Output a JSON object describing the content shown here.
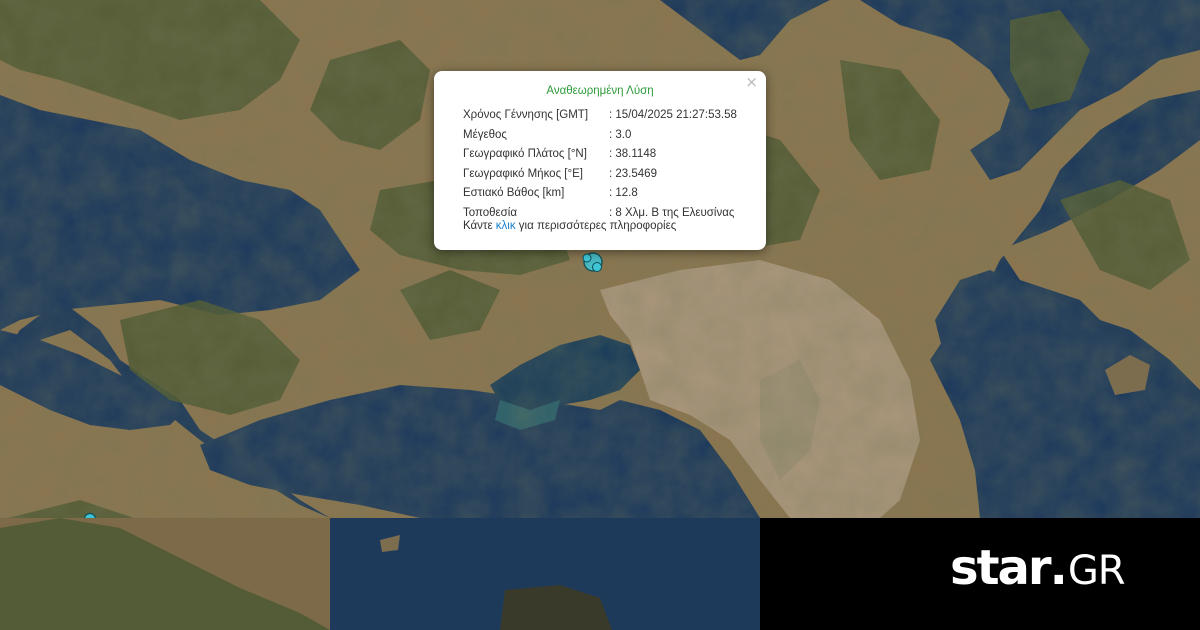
{
  "popup": {
    "title": "Αναθεωρημένη Λύση",
    "close": "×",
    "rows": [
      {
        "label": "Χρόνος Γέννησης [GMT]",
        "value": ": 15/04/2025 21:27:53.58"
      },
      {
        "label": "Μέγεθος",
        "value": ": 3.0"
      },
      {
        "label": "Γεωγραφικό Πλάτος [°N]",
        "value": ": 38.1148"
      },
      {
        "label": "Γεωγραφικό Μήκος [°E]",
        "value": ": 23.5469"
      },
      {
        "label": "Εστιακό Βάθος [km]",
        "value": ": 12.8"
      },
      {
        "label": "Τοποθεσία",
        "value": ": 8 Χλμ. Β της Ελευσίνας"
      }
    ],
    "more_prefix": "Κάντε ",
    "more_link": "κλικ",
    "more_suffix": " για περισσότερες πληροφορίες"
  },
  "markers": [
    {
      "name": "epicenter-marker",
      "color": "#3ec6d6"
    },
    {
      "name": "secondary-marker",
      "color": "#3ec6d6"
    }
  ],
  "logo": {
    "star": "star",
    "dot": ".",
    "gr": "GR"
  },
  "colors": {
    "sea": "#1d3a5c",
    "land": "#8a7550",
    "vegetation": "#4f5b34",
    "urban": "#b3a08a",
    "accent": "#2e9a3a",
    "link": "#1a7fd0"
  }
}
